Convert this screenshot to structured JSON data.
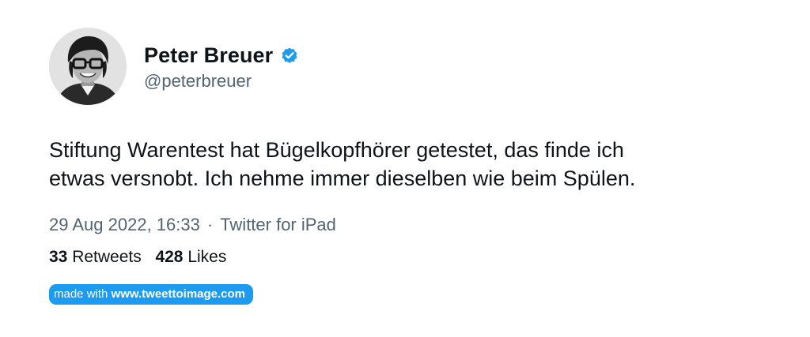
{
  "tweet": {
    "display_name": "Peter Breuer",
    "handle": "@peterbreuer",
    "verified_icon": "verified-badge-icon",
    "text": "Stiftung Warentest hat Bügelkopfhörer getestet, das finde ich\netwas versnobt. Ich nehme immer dieselben wie beim Spülen.",
    "timestamp": "29 Aug 2022, 16:33",
    "separator": "·",
    "source": "Twitter for iPad",
    "retweets_count": "33",
    "retweets_label": "Retweets",
    "likes_count": "428",
    "likes_label": "Likes"
  },
  "badge": {
    "prefix": "made with ",
    "site": "www.tweettoimage.com"
  },
  "colors": {
    "accent": "#1d9bf0",
    "text": "#0f1419",
    "secondary": "#536471"
  }
}
